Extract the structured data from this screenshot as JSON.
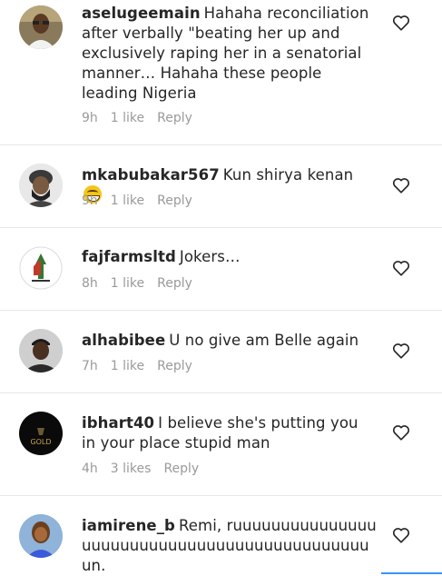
{
  "comments": [
    {
      "username": "aselugeemain",
      "text": "Hahaha reconciliation after verbally \"beating her up and exclusively raping her in a senatorial manner… Hahaha these people leading Nigeria",
      "time": "9h",
      "likes": "1 like",
      "reply": "Reply",
      "avatar_icon": "avatar-man-glasses"
    },
    {
      "username": "mkabubakar567",
      "text": "Kun shirya kenan",
      "emoji": "grinning-squint-emoji",
      "time": "9h",
      "likes": "1 like",
      "reply": "Reply",
      "avatar_icon": "avatar-bearded-man-turban"
    },
    {
      "username": "fajfarmsltd",
      "text": "Jokers…",
      "time": "8h",
      "likes": "1 like",
      "reply": "Reply",
      "avatar_icon": "avatar-farm-logo"
    },
    {
      "username": "alhabibee",
      "text": "U no give am Belle again",
      "time": "7h",
      "likes": "1 like",
      "reply": "Reply",
      "avatar_icon": "avatar-man-cap"
    },
    {
      "username": "ibhart40",
      "text": "I believe she's putting you in your place stupid man",
      "time": "4h",
      "likes": "3 likes",
      "reply": "Reply",
      "avatar_icon": "avatar-gold-logo"
    },
    {
      "username": "iamirene_b",
      "text": "Remi, ruuuuuuuuuuuuuuuuuuuuuuuuuuuuuuuuuuuuuuuuuuuuuun.",
      "time": "",
      "likes": "",
      "reply": "",
      "avatar_icon": "avatar-woman-selfie"
    }
  ],
  "avatar_gold_text": "GOLD",
  "colors": {
    "text": "#262626",
    "meta": "#9a9a9a",
    "divider": "#e6e6e6",
    "accent": "#3897f0"
  }
}
